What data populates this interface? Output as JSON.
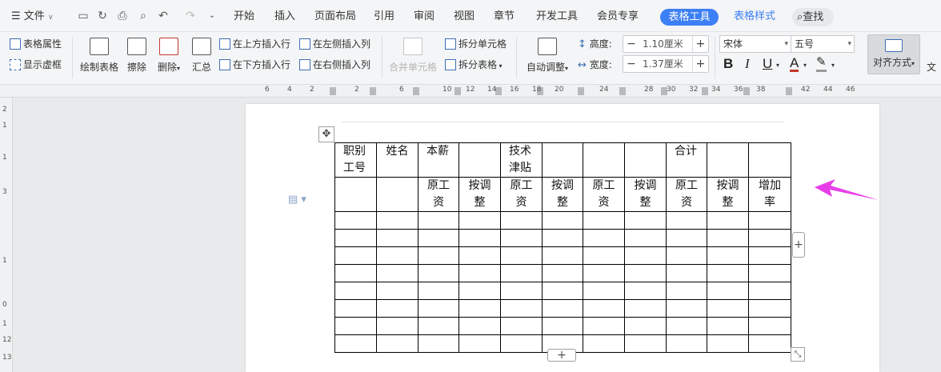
{
  "menubar": {
    "file_label": "文件",
    "tabs": [
      "开始",
      "插入",
      "页面布局",
      "引用",
      "审阅",
      "视图",
      "章节",
      "开发工具",
      "会员专享"
    ],
    "active_tab": "表格工具",
    "style_tab": "表格样式",
    "search_label": "查找"
  },
  "ribbon": {
    "table_props": "表格属性",
    "show_gridlines": "显示虚框",
    "draw_table": "绘制表格",
    "erase": "擦除",
    "delete": "删除",
    "summary": "汇总",
    "insert_above": "在上方插入行",
    "insert_below": "在下方插入行",
    "insert_left": "在左侧插入列",
    "insert_right": "在右侧插入列",
    "merge_cells": "合并单元格",
    "split_cells": "拆分单元格",
    "split_table": "拆分表格",
    "auto_fit": "自动调整",
    "height_label": "高度:",
    "height_value": "1.10厘米",
    "width_label": "宽度:",
    "width_value": "1.37厘米",
    "font_name": "宋体",
    "font_size": "五号",
    "align_label": "对齐方式",
    "text_dir_label": "文"
  },
  "ruler": {
    "labels": [
      "6",
      "4",
      "2",
      "2",
      "6",
      "10",
      "12",
      "14",
      "16",
      "18",
      "20",
      "24",
      "28",
      "30",
      "32",
      "34",
      "36",
      "38",
      "42",
      "44",
      "46"
    ],
    "vlabels": [
      "2",
      "1",
      "1",
      "3",
      "1",
      "0",
      "1",
      "12",
      "13"
    ]
  },
  "table": {
    "header_row1": [
      "职别\n工号",
      "姓名",
      "本薪",
      "",
      "技术\n津贴",
      "",
      "",
      "",
      "合计",
      "",
      ""
    ],
    "header_row2": [
      "",
      "",
      "原工\n资",
      "按调\n整",
      "原工\n资",
      "按调\n整",
      "原工\n资",
      "按调\n整",
      "原工\n资",
      "按调\n整",
      "增加\n率"
    ],
    "empty_rows": 8,
    "columns": 11
  },
  "colors": {
    "accent": "#3d7ff5",
    "arrow": "#e83ee8"
  }
}
